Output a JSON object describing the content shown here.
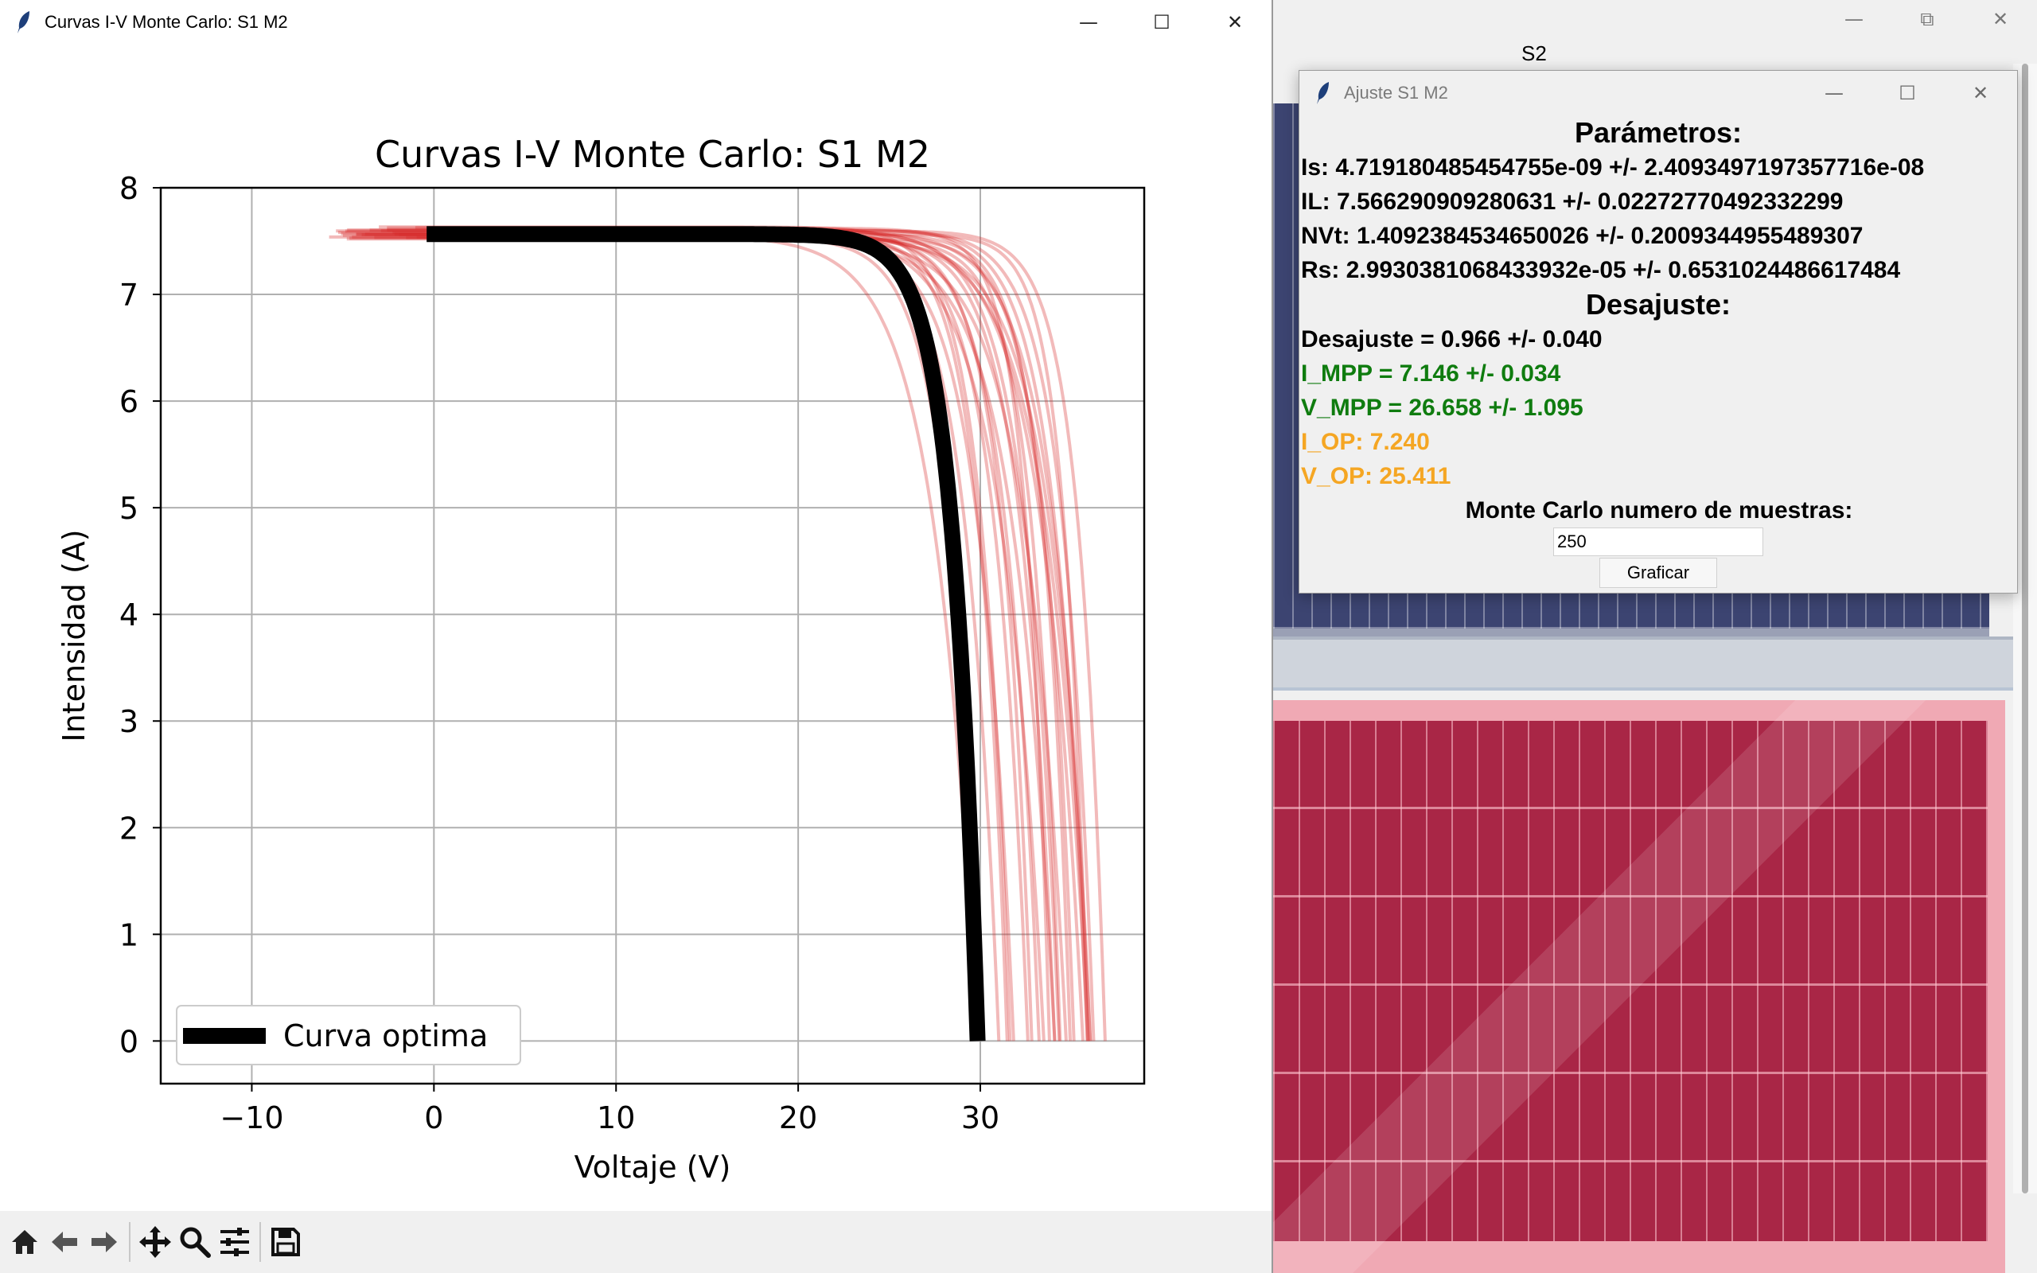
{
  "background_window": {
    "label": "S2",
    "controls": {
      "minimize": "—",
      "restore": "⧉",
      "close": "✕"
    }
  },
  "main_window": {
    "title": "Curvas I-V Monte Carlo: S1 M2",
    "controls": {
      "minimize": "—",
      "maximize": "☐",
      "close": "✕"
    }
  },
  "toolbar": {
    "buttons": [
      "home-icon",
      "back-arrow-icon",
      "forward-arrow-icon",
      "pan-move-icon",
      "zoom-magnifier-icon",
      "configure-subplots-icon",
      "save-floppy-icon"
    ]
  },
  "ajuste_window": {
    "title": "Ajuste S1 M2",
    "controls": {
      "minimize": "—",
      "maximize": "☐",
      "close": "✕"
    },
    "parametros_header": "Parámetros:",
    "is_line": "Is: 4.719180485454755e-09 +/- 2.4093497197357716e-08",
    "il_line": "IL: 7.566290909280631 +/- 0.02272770492332299",
    "nvt_line": "NVt: 1.4092384534650026 +/- 0.2009344955489307",
    "rs_line": "Rs: 2.9930381068433932e-05 +/- 0.6531024486617484",
    "desajuste_header": "Desajuste:",
    "desajuste_line": "Desajuste = 0.966 +/- 0.040",
    "impp_line": "I_MPP = 7.146 +/- 0.034",
    "vmpp_line": "V_MPP = 26.658 +/- 1.095",
    "iop_line": "I_OP: 7.240",
    "vop_line": "V_OP: 25.411",
    "montecarlo_label": "Monte Carlo numero de muestras:",
    "samples_value": "250",
    "graficar_label": "Graficar",
    "colors": {
      "mpp": "#0f7c0f",
      "op": "#f5a623"
    }
  },
  "chart_data": {
    "type": "line",
    "title": "Curvas I-V Monte Carlo: S1 M2",
    "xlabel": "Voltaje (V)",
    "ylabel": "Intensidad (A)",
    "xlim": [
      -15,
      39
    ],
    "ylim": [
      -0.4,
      8
    ],
    "xticks": [
      -10,
      0,
      10,
      20,
      30
    ],
    "xtick_labels": [
      "−10",
      "0",
      "10",
      "20",
      "30"
    ],
    "yticks": [
      0,
      1,
      2,
      3,
      4,
      5,
      6,
      7,
      8
    ],
    "grid": true,
    "legend": {
      "position": "lower-left",
      "entries": [
        "Curva optima"
      ]
    },
    "optimal_curve": {
      "name": "Curva optima",
      "color": "#000000",
      "params": {
        "IL": 7.566,
        "Is": 4.719e-09,
        "NVt": 1.409,
        "Rs": 0.0
      },
      "x_start": -0.4,
      "x_end": 29.85
    },
    "monte_carlo_series": {
      "color": "#d62728",
      "samples_shown": 26,
      "voc_range": [
        29.8,
        36.9
      ],
      "x_start_range": [
        -6.2,
        -0.5
      ]
    }
  }
}
